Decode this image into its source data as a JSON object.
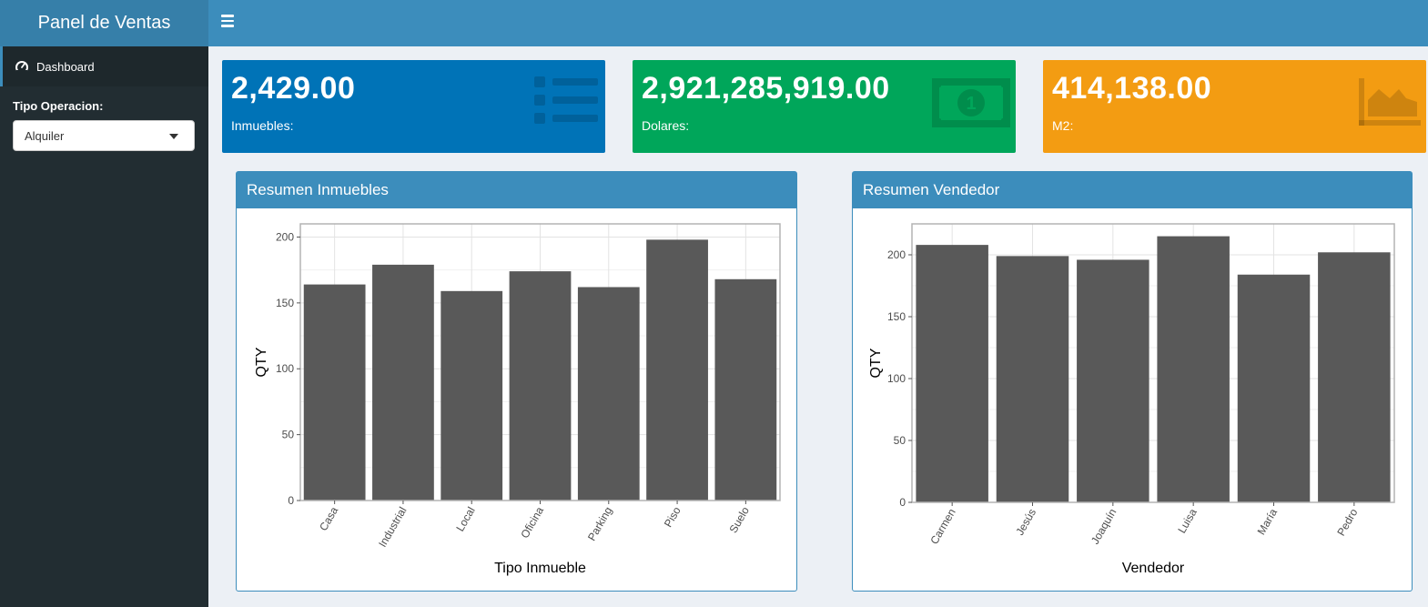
{
  "app": {
    "title": "Panel de Ventas"
  },
  "sidebar": {
    "menu": [
      {
        "label": "Dashboard",
        "icon": "dashboard-icon"
      }
    ],
    "filter": {
      "label": "Tipo Operacion:",
      "selected": "Alquiler"
    }
  },
  "value_boxes": [
    {
      "value": "2,429.00",
      "label": "Inmuebles:",
      "icon": "list-icon",
      "color": "#0073b7"
    },
    {
      "value": "2,921,285,919.00",
      "label": "Dolares:",
      "icon": "money-icon",
      "color": "#00a65a"
    },
    {
      "value": "414,138.00",
      "label": "M2:",
      "icon": "area-chart-icon",
      "color": "#f39c12"
    }
  ],
  "panels": {
    "left": {
      "title": "Resumen Inmuebles"
    },
    "right": {
      "title": "Resumen Vendedor"
    }
  },
  "chart_data": [
    {
      "type": "bar",
      "categories": [
        "Casa",
        "Industrial",
        "Local",
        "Oficina",
        "Parking",
        "Piso",
        "Suelo"
      ],
      "values": [
        164,
        179,
        159,
        174,
        162,
        198,
        168
      ],
      "xlabel": "Tipo Inmueble",
      "ylabel": "QTY",
      "ylim": [
        0,
        210
      ],
      "yticks": [
        0,
        50,
        100,
        150,
        200
      ],
      "grid": true,
      "bar_color": "#595959"
    },
    {
      "type": "bar",
      "categories": [
        "Carmen",
        "Jesús",
        "Joaquín",
        "Luisa",
        "María",
        "Pedro"
      ],
      "values": [
        208,
        199,
        196,
        215,
        184,
        202
      ],
      "xlabel": "Vendedor",
      "ylabel": "QTY",
      "ylim": [
        0,
        225
      ],
      "yticks": [
        0,
        50,
        100,
        150,
        200
      ],
      "grid": true,
      "bar_color": "#595959"
    }
  ]
}
